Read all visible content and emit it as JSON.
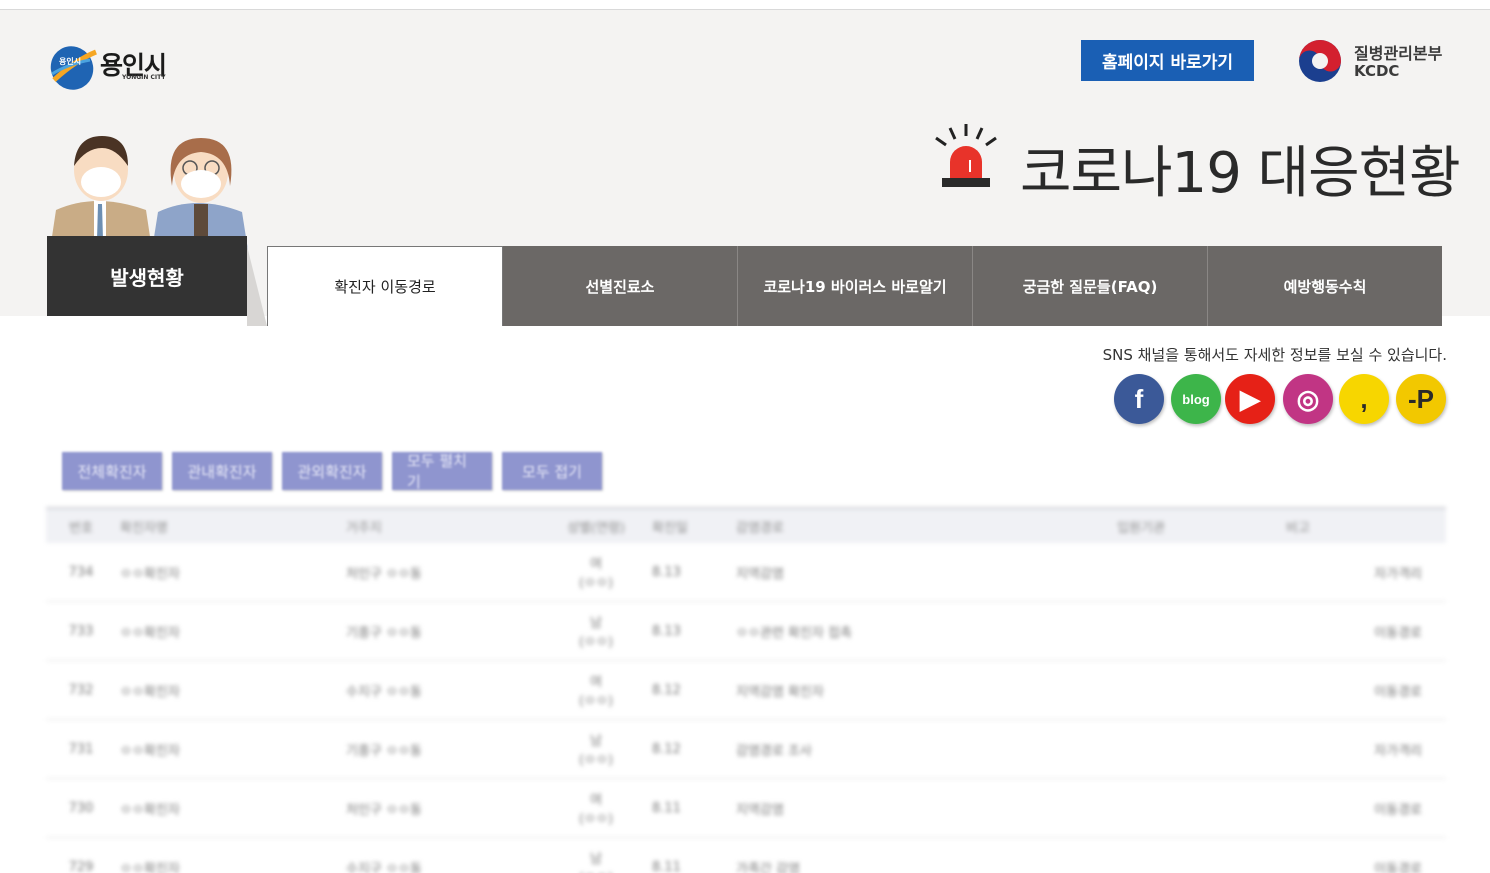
{
  "header": {
    "logo_text": "용인시",
    "logo_sub": "YONGIN CITY",
    "logo_badge": "용인시",
    "home_button": "홈페이지 바로가기",
    "agency_name": "질병관리본부",
    "agency_en": "KCDC",
    "page_title": "코로나19  대응현황"
  },
  "nav": {
    "main_tab": "발생현황",
    "tabs": [
      {
        "label": "확진자 이동경로",
        "active": true
      },
      {
        "label": "선별진료소",
        "active": false
      },
      {
        "label": "코로나19 바이러스 바로알기",
        "active": false
      },
      {
        "label": "궁금한 질문들(FAQ)",
        "active": false
      },
      {
        "label": "예방행동수칙",
        "active": false
      }
    ]
  },
  "sns": {
    "notice": "SNS 채널을 통해서도 자세한 정보를 보실 수 있습니다.",
    "channels": [
      {
        "name": "facebook-icon",
        "color": "#3b5998",
        "glyph": "f"
      },
      {
        "name": "blog-icon",
        "color": "#3db54a",
        "glyph": "blog"
      },
      {
        "name": "youtube-icon",
        "color": "#e62117",
        "glyph": "▶"
      },
      {
        "name": "instagram-icon",
        "color": "#c13584",
        "glyph": "◎"
      },
      {
        "name": "kakaostory-icon",
        "color": "#f7d600",
        "glyph": ","
      },
      {
        "name": "kakaopage-icon",
        "color": "#f2c800",
        "glyph": "-P"
      }
    ]
  },
  "filters": [
    "전체확진자",
    "관내확진자",
    "관외확진자",
    "모두 펼치기",
    "모두 접기"
  ],
  "table": {
    "headers": [
      "번호",
      "확진자명",
      "거주지",
      "성별(연령)",
      "확진일",
      "감염경로",
      "입원기관",
      "비고"
    ],
    "rows": [
      [
        "734",
        "ㅇㅇ확진자",
        "처인구 ㅇㅇ동",
        "여\n(ㅇㅇ)",
        "8.13",
        "지역감염",
        "",
        "자가격리"
      ],
      [
        "733",
        "ㅇㅇ확진자",
        "기흥구 ㅇㅇ동",
        "남\n(ㅇㅇ)",
        "8.13",
        "ㅇㅇ관련 확진자 접촉",
        "",
        "이동경로"
      ],
      [
        "732",
        "ㅇㅇ확진자",
        "수지구 ㅇㅇ동",
        "여\n(ㅇㅇ)",
        "8.12",
        "지역감염 확진자",
        "",
        "이동경로"
      ],
      [
        "731",
        "ㅇㅇ확진자",
        "기흥구 ㅇㅇ동",
        "남\n(ㅇㅇ)",
        "8.12",
        "감염경로 조사",
        "",
        "자가격리"
      ],
      [
        "730",
        "ㅇㅇ확진자",
        "처인구 ㅇㅇ동",
        "여\n(ㅇㅇ)",
        "8.11",
        "지역감염",
        "",
        "이동경로"
      ],
      [
        "729",
        "ㅇㅇ확진자",
        "수지구 ㅇㅇ동",
        "남\n(ㅇㅇ)",
        "8.11",
        "가족간 감염",
        "",
        "이동경로"
      ]
    ]
  }
}
